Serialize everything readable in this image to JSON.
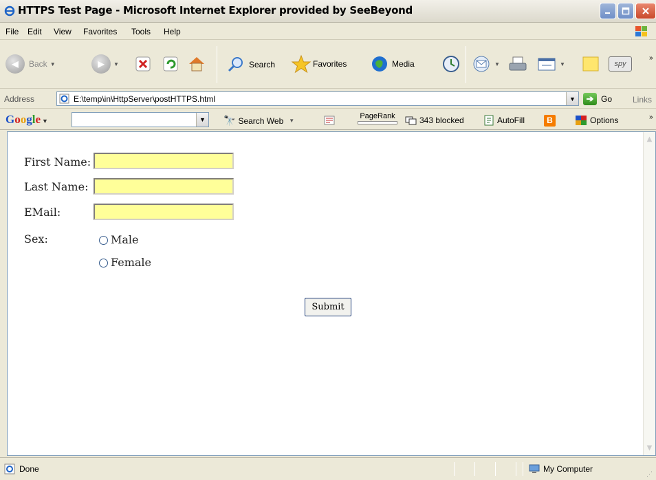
{
  "window": {
    "title": "HTTPS Test Page - Microsoft Internet Explorer provided by SeeBeyond"
  },
  "menu": [
    "File",
    "Edit",
    "View",
    "Favorites",
    "Tools",
    "Help"
  ],
  "toolbar": {
    "back_label": "Back",
    "search_label": "Search",
    "favorites_label": "Favorites",
    "media_label": "Media",
    "spy_label": "spy"
  },
  "address": {
    "label": "Address",
    "url": "E:\\temp\\in\\HttpServer\\postHTTPS.html",
    "go_label": "Go",
    "links_label": "Links"
  },
  "google_toolbar": {
    "logo": "Google",
    "search_web_label": "Search Web",
    "pagerank_label": "PageRank",
    "blocked_label": "343 blocked",
    "autofill_label": "AutoFill",
    "options_label": "Options"
  },
  "form": {
    "first_name_label": "First Name:",
    "last_name_label": "Last Name:",
    "email_label": "EMail:",
    "sex_label": "Sex:",
    "male_label": "Male",
    "female_label": "Female",
    "submit_label": "Submit",
    "field_color": "#ffff99"
  },
  "status": {
    "text": "Done",
    "zone": "My Computer"
  },
  "colors": {
    "chrome": "#ece9d8",
    "border": "#7f9db9"
  }
}
